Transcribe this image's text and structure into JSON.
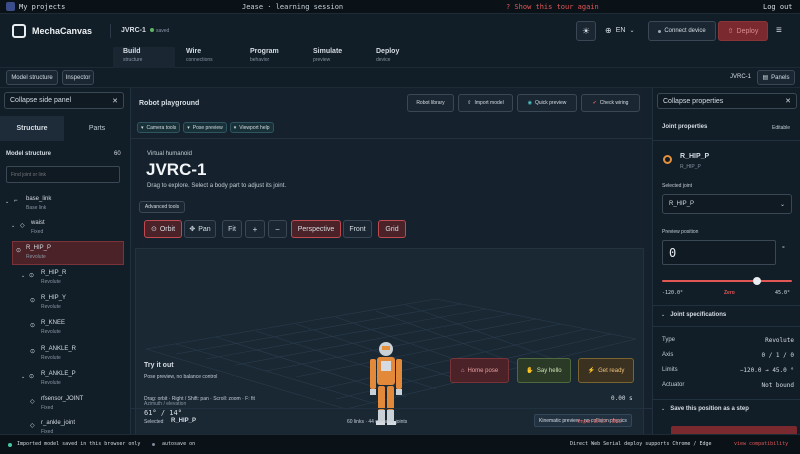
{
  "topbar": {
    "back_label": "My projects",
    "user_session": "Jease · learning session",
    "tour_link": "? Show this tour again",
    "logout_label": "Log out"
  },
  "header": {
    "app_name": "MechaCanvas",
    "project_name": "JVRC-1",
    "save_status": "saved",
    "tabs": [
      {
        "label": "Build",
        "sub": "structure"
      },
      {
        "label": "Wire",
        "sub": "connections"
      },
      {
        "label": "Program",
        "sub": "behavior"
      },
      {
        "label": "Simulate",
        "sub": "preview"
      },
      {
        "label": "Deploy",
        "sub": "device"
      }
    ],
    "language": "EN",
    "connect_label": "Connect device",
    "deploy_label": "Deploy"
  },
  "toolrow": {
    "model_structure_label": "Model structure",
    "inspector_label": "Inspector",
    "robot_name": "JVRC-1",
    "panels_label": "Panels"
  },
  "left": {
    "collapse_label": "Collapse side panel",
    "tabs": [
      "Structure",
      "Parts"
    ],
    "section_title": "Model structure",
    "count": "60",
    "search_placeholder": "Find joint or link",
    "items": [
      {
        "name": "base_link",
        "type": "Base link"
      },
      {
        "name": "waist",
        "type": "Fixed"
      },
      {
        "name": "R_HIP_P",
        "type": "Revolute"
      },
      {
        "name": "R_HIP_R",
        "type": "Revolute"
      },
      {
        "name": "R_HIP_Y",
        "type": "Revolute"
      },
      {
        "name": "R_KNEE",
        "type": "Revolute"
      },
      {
        "name": "R_ANKLE_R",
        "type": "Revolute"
      },
      {
        "name": "R_ANKLE_P",
        "type": "Revolute"
      },
      {
        "name": "rfsensor_JOINT",
        "type": "Fixed"
      },
      {
        "name": "r_ankle_joint",
        "type": "Fixed"
      }
    ]
  },
  "center": {
    "title": "Robot playground",
    "library_label": "Robot library",
    "import_label": "Import model",
    "quick_preview_label": "Quick preview",
    "check_wiring_label": "Check wiring",
    "chips": [
      "Camera tools",
      "Pose preview",
      "Viewport help"
    ],
    "kind": "Virtual humanoid",
    "robot_title": "JVRC-1",
    "hint": "Drag to explore. Select a body part to adjust its joint.",
    "advanced_label": "Advanced tools",
    "view_buttons": [
      "Orbit",
      "Pan",
      "Fit",
      "+",
      "−",
      "Perspective",
      "Front",
      "Grid"
    ],
    "azimuth_label": "Azimuth / elevation",
    "azimuth_value": "61° / 14°",
    "preview_badge": "Kinematic preview · no collision physics",
    "try_title": "Try it out",
    "try_sub": "Pose preview, no balance control",
    "home_pose_label": "Home pose",
    "say_hello_label": "Say hello",
    "get_ready_label": "Get ready",
    "drag_help": "Drag: orbit · Right / Shift: pan · Scroll: zoom · F: fit",
    "time_value": "0.00 s",
    "selected_label": "Selected",
    "selected_value": "R_HIP_P",
    "links_info": "60 links · 44 movable joints",
    "import_urdf_label": "Import URDF / USD"
  },
  "right": {
    "collapse_label": "Collapse properties",
    "section_title": "Joint properties",
    "editable_label": "Editable",
    "joint_name": "R_HIP_P",
    "joint_sub": "R_HIP_P",
    "selected_joint_label": "Selected joint",
    "selected_joint_value": "R_HIP_P",
    "preview_position_label": "Preview position",
    "position_value": "0",
    "degree_unit": "°",
    "slider_min": "-120.0°",
    "slider_mid": "Zero",
    "slider_max": "45.0°",
    "slider_fraction": 0.727,
    "specs_title": "Joint specifications",
    "specs": [
      {
        "key": "Type",
        "value": "Revolute"
      },
      {
        "key": "Axis",
        "value": "0 / 1 / 0"
      },
      {
        "key": "Limits",
        "value": "−120.0 → 45.0 °"
      },
      {
        "key": "Actuator",
        "value": "Not bound"
      }
    ],
    "save_step_label": "Save this position as a step"
  },
  "status": {
    "import_note": "Imported model saved in this browser only",
    "autosave": "autosave on",
    "serial_note": "Direct Web Serial deploy supports Chrome / Edge",
    "view_compat": "view compatibility"
  }
}
